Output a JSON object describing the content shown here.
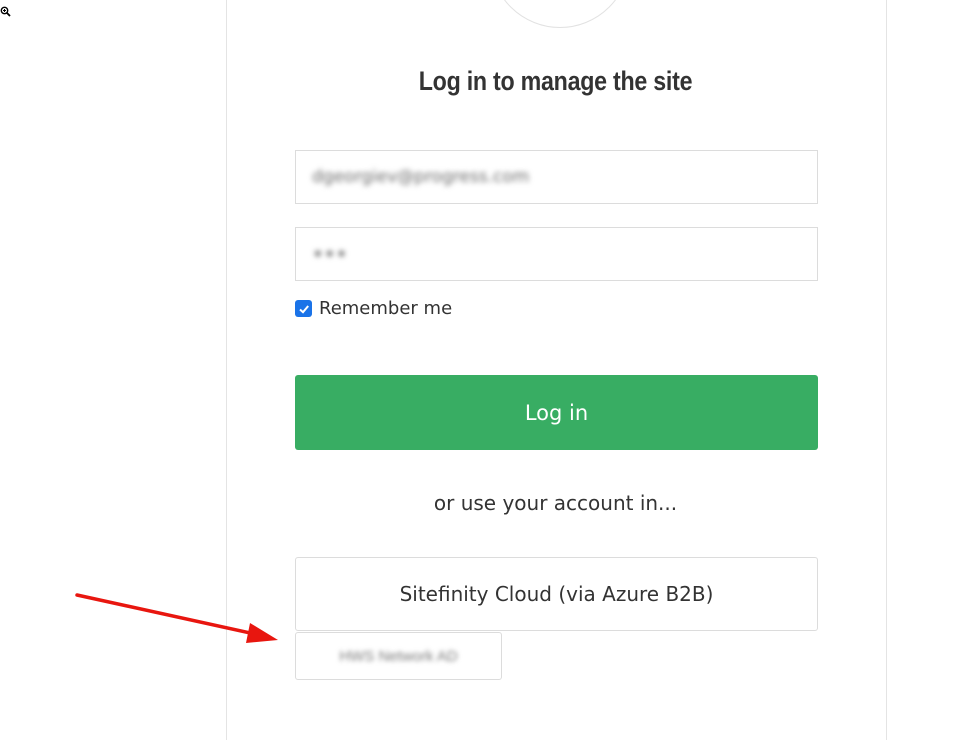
{
  "page": {
    "title": "Log in to manage the site"
  },
  "form": {
    "email_value": "dgeorgiev@progress.com",
    "password_value": "•••",
    "remember_label": "Remember me",
    "remember_checked": true,
    "login_label": "Log in"
  },
  "alternatives": {
    "prompt": "or use your account in...",
    "providers": [
      {
        "label": "Sitefinity Cloud (via Azure B2B)"
      },
      {
        "label": "HWS Network AD"
      }
    ]
  },
  "icons": {
    "zoom": "zoom-in-icon",
    "check": "check-icon",
    "arrow": "annotation-arrow-icon"
  },
  "colors": {
    "accent_green": "#38ad63",
    "checkbox_blue": "#1a73e8",
    "arrow_red": "#e8160f",
    "text": "#333333"
  }
}
